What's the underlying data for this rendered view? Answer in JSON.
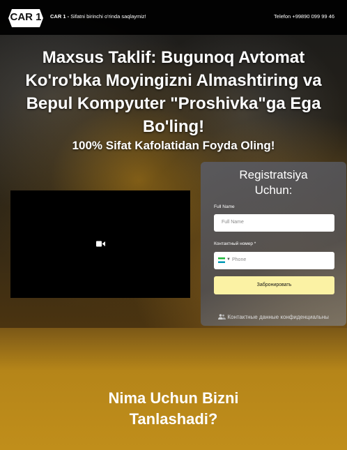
{
  "header": {
    "logo_text": "CAR 1",
    "brand_short": "CAR 1 -",
    "tagline": "Sifatni birinchi o'rinda saqlaymiz!",
    "phone": "Telefon +99890 099 99 46"
  },
  "hero": {
    "headline": "Maxsus Taklif: Bugunoq Avtomat Ko'ro'bka Moyingizni Almashtiring va Bepul Kompyuter \"Proshivka\"ga Ega Bo'ling!",
    "subheadline": "100% Sifat Kafolatidan Foyda Oling!",
    "video_icon": "video-camera-icon"
  },
  "form": {
    "title": "Registratsiya Uchun:",
    "name_label": "Full Name",
    "name_placeholder": "Full Name",
    "phone_label": "Контактный номер *",
    "phone_placeholder": "Phone",
    "country_flag": "uz-flag-icon",
    "submit_label": "Забронировать",
    "privacy_text": "Контактные данные конфиденциальны",
    "privacy_icon": "users-icon"
  },
  "section": {
    "why_title": "Nima Uchun Bizni Tanlashadi?"
  },
  "colors": {
    "submit_bg": "#fbf2a4",
    "gold_bg": "#c08e1b"
  }
}
